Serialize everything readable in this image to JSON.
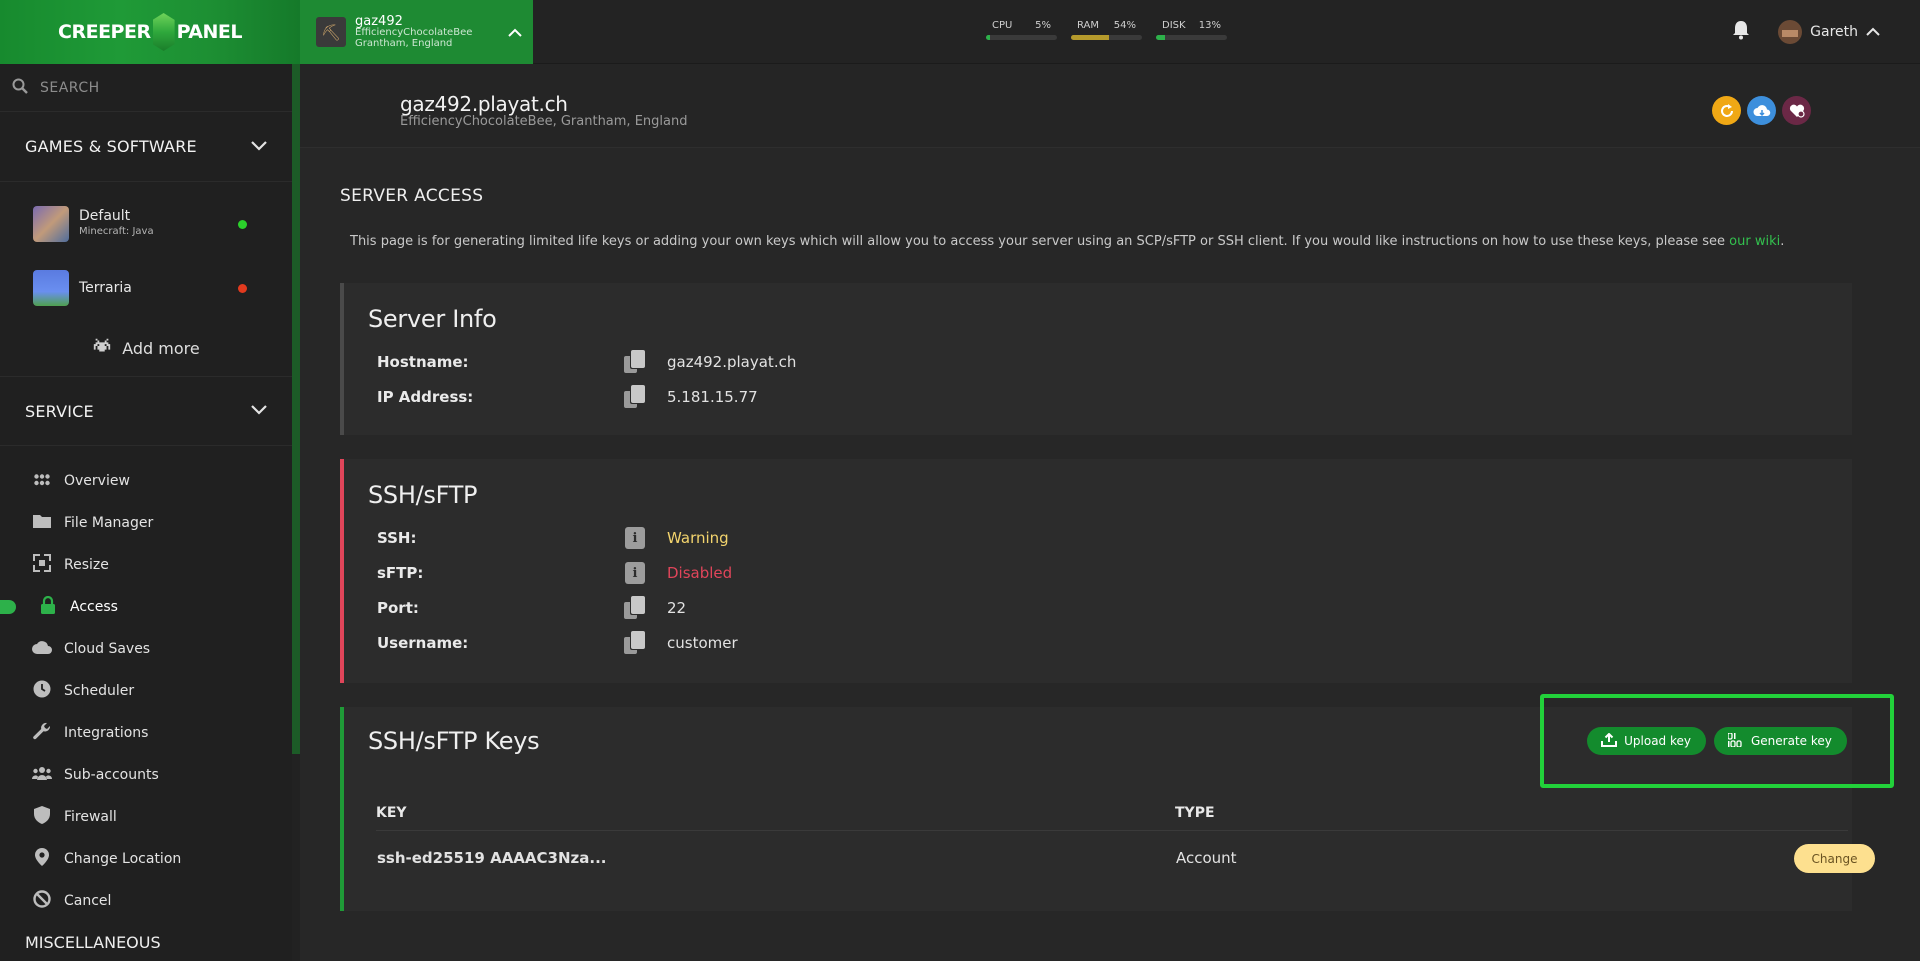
{
  "topbar": {
    "logo_left": "CREEPER",
    "logo_right": "PANEL",
    "server": {
      "name": "gaz492",
      "line1": "EfficiencyChocolateBee",
      "line2": "Grantham, England"
    },
    "stats": [
      {
        "label": "CPU",
        "value": "5%",
        "fraction": 0.05,
        "color": "#2db14a"
      },
      {
        "label": "RAM",
        "value": "54%",
        "fraction": 0.54,
        "color": "#b59a2c"
      },
      {
        "label": "DISK",
        "value": "13%",
        "fraction": 0.13,
        "color": "#2db14a"
      }
    ],
    "user_name": "Gareth"
  },
  "sidebar": {
    "search_placeholder": "SEARCH",
    "games_heading": "GAMES & SOFTWARE",
    "games": [
      {
        "name": "Default",
        "sub": "Minecraft: Java",
        "status_color": "#2bd12b"
      },
      {
        "name": "Terraria",
        "sub": "",
        "status_color": "#e23a1e"
      }
    ],
    "add_more": "Add more",
    "service_heading": "SERVICE",
    "nav": [
      {
        "label": "Overview",
        "icon": "grid-icon"
      },
      {
        "label": "File Manager",
        "icon": "folder-icon"
      },
      {
        "label": "Resize",
        "icon": "resize-icon"
      },
      {
        "label": "Access",
        "icon": "lock-icon"
      },
      {
        "label": "Cloud Saves",
        "icon": "cloud-icon"
      },
      {
        "label": "Scheduler",
        "icon": "clock-icon"
      },
      {
        "label": "Integrations",
        "icon": "wrench-icon"
      },
      {
        "label": "Sub-accounts",
        "icon": "users-icon"
      },
      {
        "label": "Firewall",
        "icon": "shield-icon"
      },
      {
        "label": "Change Location",
        "icon": "pin-icon"
      },
      {
        "label": "Cancel",
        "icon": "ban-icon"
      }
    ],
    "misc_heading": "MISCELLANEOUS"
  },
  "header": {
    "title": "gaz492.playat.ch",
    "subtitle": "EfficiencyChocolateBee, Grantham, England"
  },
  "page": {
    "section_title": "SERVER ACCESS",
    "intro": "This page is for generating limited life keys or adding your own keys which will allow you to access your server using an SCP/sFTP or SSH client. If you would like instructions on how to use these keys, please see ",
    "intro_link": "our wiki",
    "intro_end": "."
  },
  "server_info": {
    "title": "Server Info",
    "hostname_label": "Hostname:",
    "hostname_value": "gaz492.playat.ch",
    "ip_label": "IP Address:",
    "ip_value": "5.181.15.77"
  },
  "ssh": {
    "title": "SSH/sFTP",
    "ssh_label": "SSH:",
    "ssh_value": "Warning",
    "ssh_color": "#f3d46d",
    "sftp_label": "sFTP:",
    "sftp_value": "Disabled",
    "sftp_color": "#e0455a",
    "port_label": "Port:",
    "port_value": "22",
    "user_label": "Username:",
    "user_value": "customer"
  },
  "keys": {
    "title": "SSH/sFTP Keys",
    "upload_label": "Upload key",
    "generate_label": "Generate key",
    "col_key": "KEY",
    "col_type": "TYPE",
    "rows": [
      {
        "key": "ssh-ed25519 AAAAC3Nza...",
        "type": "Account",
        "action": "Change"
      }
    ]
  }
}
